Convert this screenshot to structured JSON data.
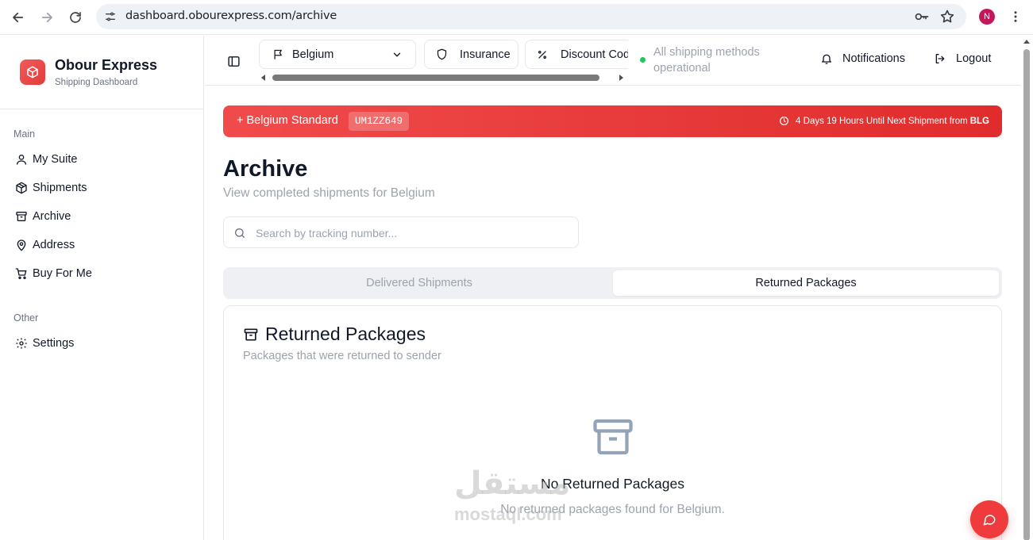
{
  "browser": {
    "url": "dashboard.obourexpress.com/archive",
    "profile_initial": "N"
  },
  "sidebar": {
    "brand_name": "Obour Express",
    "brand_sub": "Shipping Dashboard",
    "main_label": "Main",
    "other_label": "Other",
    "items": [
      {
        "label": "My Suite",
        "icon": "user-icon"
      },
      {
        "label": "Shipments",
        "icon": "package-icon"
      },
      {
        "label": "Archive",
        "icon": "archive-icon"
      },
      {
        "label": "Address",
        "icon": "map-pin-icon"
      },
      {
        "label": "Buy For Me",
        "icon": "cart-icon"
      }
    ],
    "other_items": [
      {
        "label": "Settings",
        "icon": "gear-icon"
      }
    ]
  },
  "topbar": {
    "country": "Belgium",
    "insurance": "Insurance",
    "discount": "Discount Cod",
    "status": "All shipping methods operational",
    "notifications": "Notifications",
    "logout": "Logout"
  },
  "banner": {
    "title": "+ Belgium Standard",
    "code": "UM1ZZ649",
    "countdown": "4 Days 19 Hours Until Next Shipment from",
    "from": "BLG"
  },
  "page": {
    "title": "Archive",
    "subtitle": "View completed shipments for Belgium",
    "search_placeholder": "Search by tracking number...",
    "tabs": [
      "Delivered Shipments",
      "Returned Packages"
    ],
    "active_tab": "Returned Packages"
  },
  "card": {
    "title": "Returned Packages",
    "description": "Packages that were returned to sender",
    "empty_title": "No Returned Packages",
    "empty_desc": "No returned packages found for Belgium."
  },
  "watermark": {
    "arabic": "مستقل",
    "latin": "mostaql.com"
  },
  "colors": {
    "accent": "#ef3b3b",
    "status_ok": "#22c55e"
  }
}
